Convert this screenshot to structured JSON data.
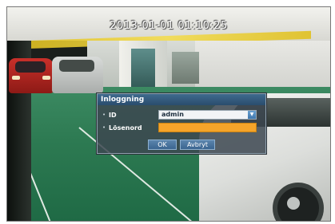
{
  "overlay": {
    "timestamp": "2013-01-01 01:10:25"
  },
  "login_dialog": {
    "title": "Inloggning",
    "fields": [
      {
        "label": "ID",
        "value": "admin"
      },
      {
        "label": "Lösenord",
        "value": ""
      }
    ],
    "ok_label": "OK",
    "cancel_label": "Avbryt"
  },
  "colors": {
    "dialog_title_bar": "#2a4d6d",
    "password_field": "#f5a42a",
    "button": "#3b6590"
  },
  "icons": {
    "dropdown": "chevron-down-icon",
    "bullet": "bullet-icon"
  }
}
